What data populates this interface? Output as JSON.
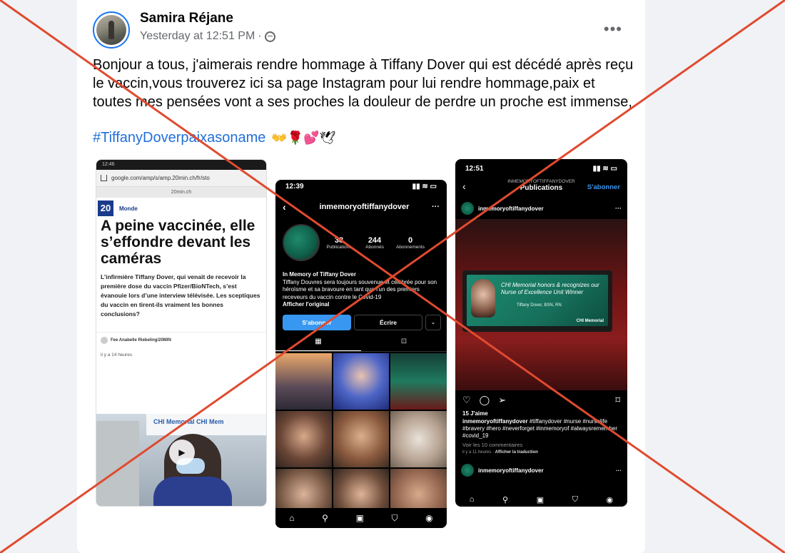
{
  "post": {
    "author": "Samira Réjane",
    "timestamp": "Yesterday at 12:51 PM",
    "separator": "·",
    "more_label": "•••",
    "body": "Bonjour a tous, j'aimerais rendre hommage à Tiffany Dover qui est décédé après reçu le vaccin,vous trouverez ici sa page Instagram pour lui rendre hommage,paix et toutes mes pensées vont a ses proches la douleur de perdre un proche est immense,",
    "hashtag": "#TiffanyDoverpaixasoname",
    "emojis": "👐🌹💕🕊"
  },
  "shot1": {
    "status": "12:46",
    "url": "google.com/amp/s/amp.20min.ch/fr/sto",
    "site": "20min.ch",
    "logo": "20",
    "section": "Monde",
    "headline": "A peine vaccinée, elle s’effondre devant les caméras",
    "lead": "L’infirmière Tiffany Dover, qui venait de recevoir la première dose du vaccin Pfizer/BioNTech, s’est évanouie lors d’une interview télévisée. Les sceptiques du vaccin en tirent-ils vraiment les bonnes conclusions?",
    "credit": "Fee Anabelle Riebeling/20MIN",
    "time_ago": "il y a 14 heures",
    "video_sign": "CHI Memorial   CHI Mem",
    "play": "▶"
  },
  "shot2": {
    "time": "12:39",
    "signal": "▮▮ ≋ ▭",
    "back": "‹",
    "username": "inmemoryoftiffanydover",
    "menu": "···",
    "stats": [
      {
        "num": "38",
        "label": "Publications"
      },
      {
        "num": "244",
        "label": "Abonnés"
      },
      {
        "num": "0",
        "label": "Abonnements"
      }
    ],
    "bio_name": "In Memory of Tiffany Dover",
    "bio_text": "Tiffany Douvres sera toujours souvenue et célébrée pour son héroïsme et sa bravoure en tant que l'un des premiers receveurs du vaccin contre le Covid-19",
    "bio_link": "Afficher l'original",
    "follow": "S'abonner",
    "message": "Écrire",
    "dropdown": "⌄",
    "tab_grid": "▦",
    "tab_tagged": "⊡",
    "nav": [
      "⌂",
      "⚲",
      "▣",
      "⛉",
      "◉"
    ]
  },
  "shot3": {
    "time": "12:51",
    "signal": "▮▮ ≋ ▭",
    "back": "‹",
    "header_small": "INMEMORYOFTIFFANYDOVER",
    "header_big": "Publications",
    "follow": "S'abonner",
    "username": "inmemoryoftiffanydover",
    "menu": "···",
    "screen_text": "CHI Memorial honors & recognizes our Nurse of Excellence Unit Winner",
    "screen_name": "Tiffany Dover, BSN, RN",
    "screen_logo": "CHI Memorial",
    "actions": [
      "♡",
      "◯",
      "➢"
    ],
    "save": "⌑",
    "likes": "15 J'aime",
    "caption": "#tiffanydover #nurse #nurselife #bravery #hero #neverforget #inmemoryof #alwaysremember #covid_19",
    "comments": "Voir les 10 commentaires",
    "ago": "il y a 11 heures ·",
    "translate": "Afficher la traduction",
    "next_user": "inmemoryoftiffanydover",
    "nav": [
      "⌂",
      "⚲",
      "▣",
      "⛉",
      "◉"
    ]
  },
  "colors": {
    "cross": "#e04a2f",
    "link": "#216fdb",
    "ig_blue": "#3897f0"
  }
}
